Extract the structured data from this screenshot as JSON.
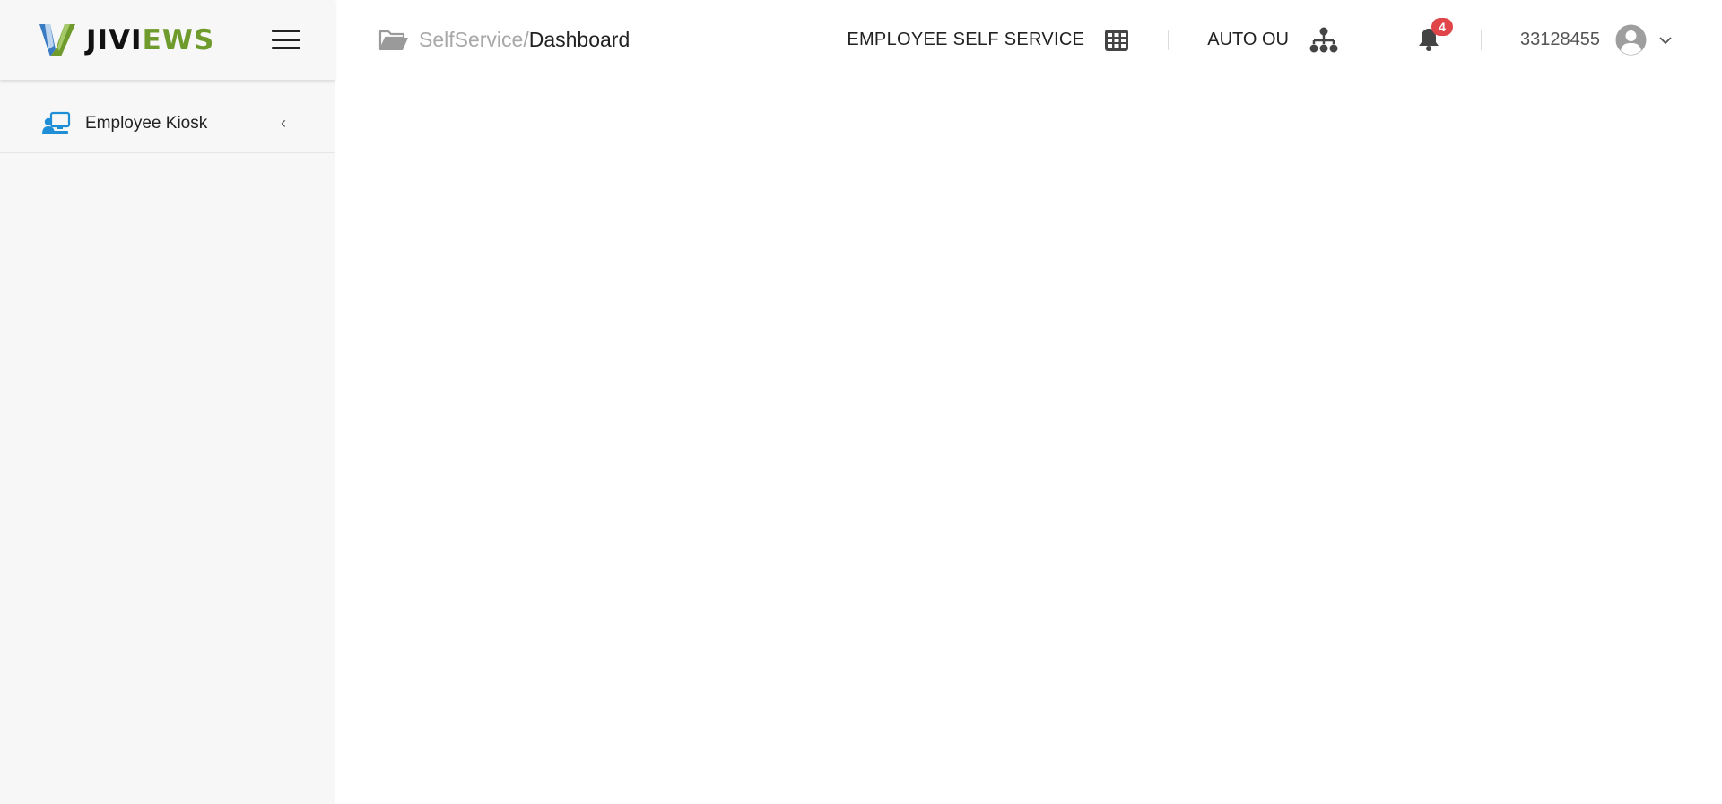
{
  "brand": {
    "logo_black": "JIVI",
    "logo_green": "EWS",
    "colors": {
      "green": "#6f9a2c",
      "blue": "#1f6fb5"
    }
  },
  "sidebar": {
    "items": [
      {
        "label": "Employee Kiosk",
        "icon": "employee-kiosk-icon",
        "chevron": "‹"
      }
    ]
  },
  "header": {
    "breadcrumb": {
      "parent": "SelfService/",
      "current": "Dashboard"
    },
    "module_label": "EMPLOYEE SELF SERVICE",
    "ou_label": "AUTO OU",
    "notifications": {
      "count": "4",
      "badge_color": "#e0454a"
    },
    "user_id": "33128455"
  }
}
